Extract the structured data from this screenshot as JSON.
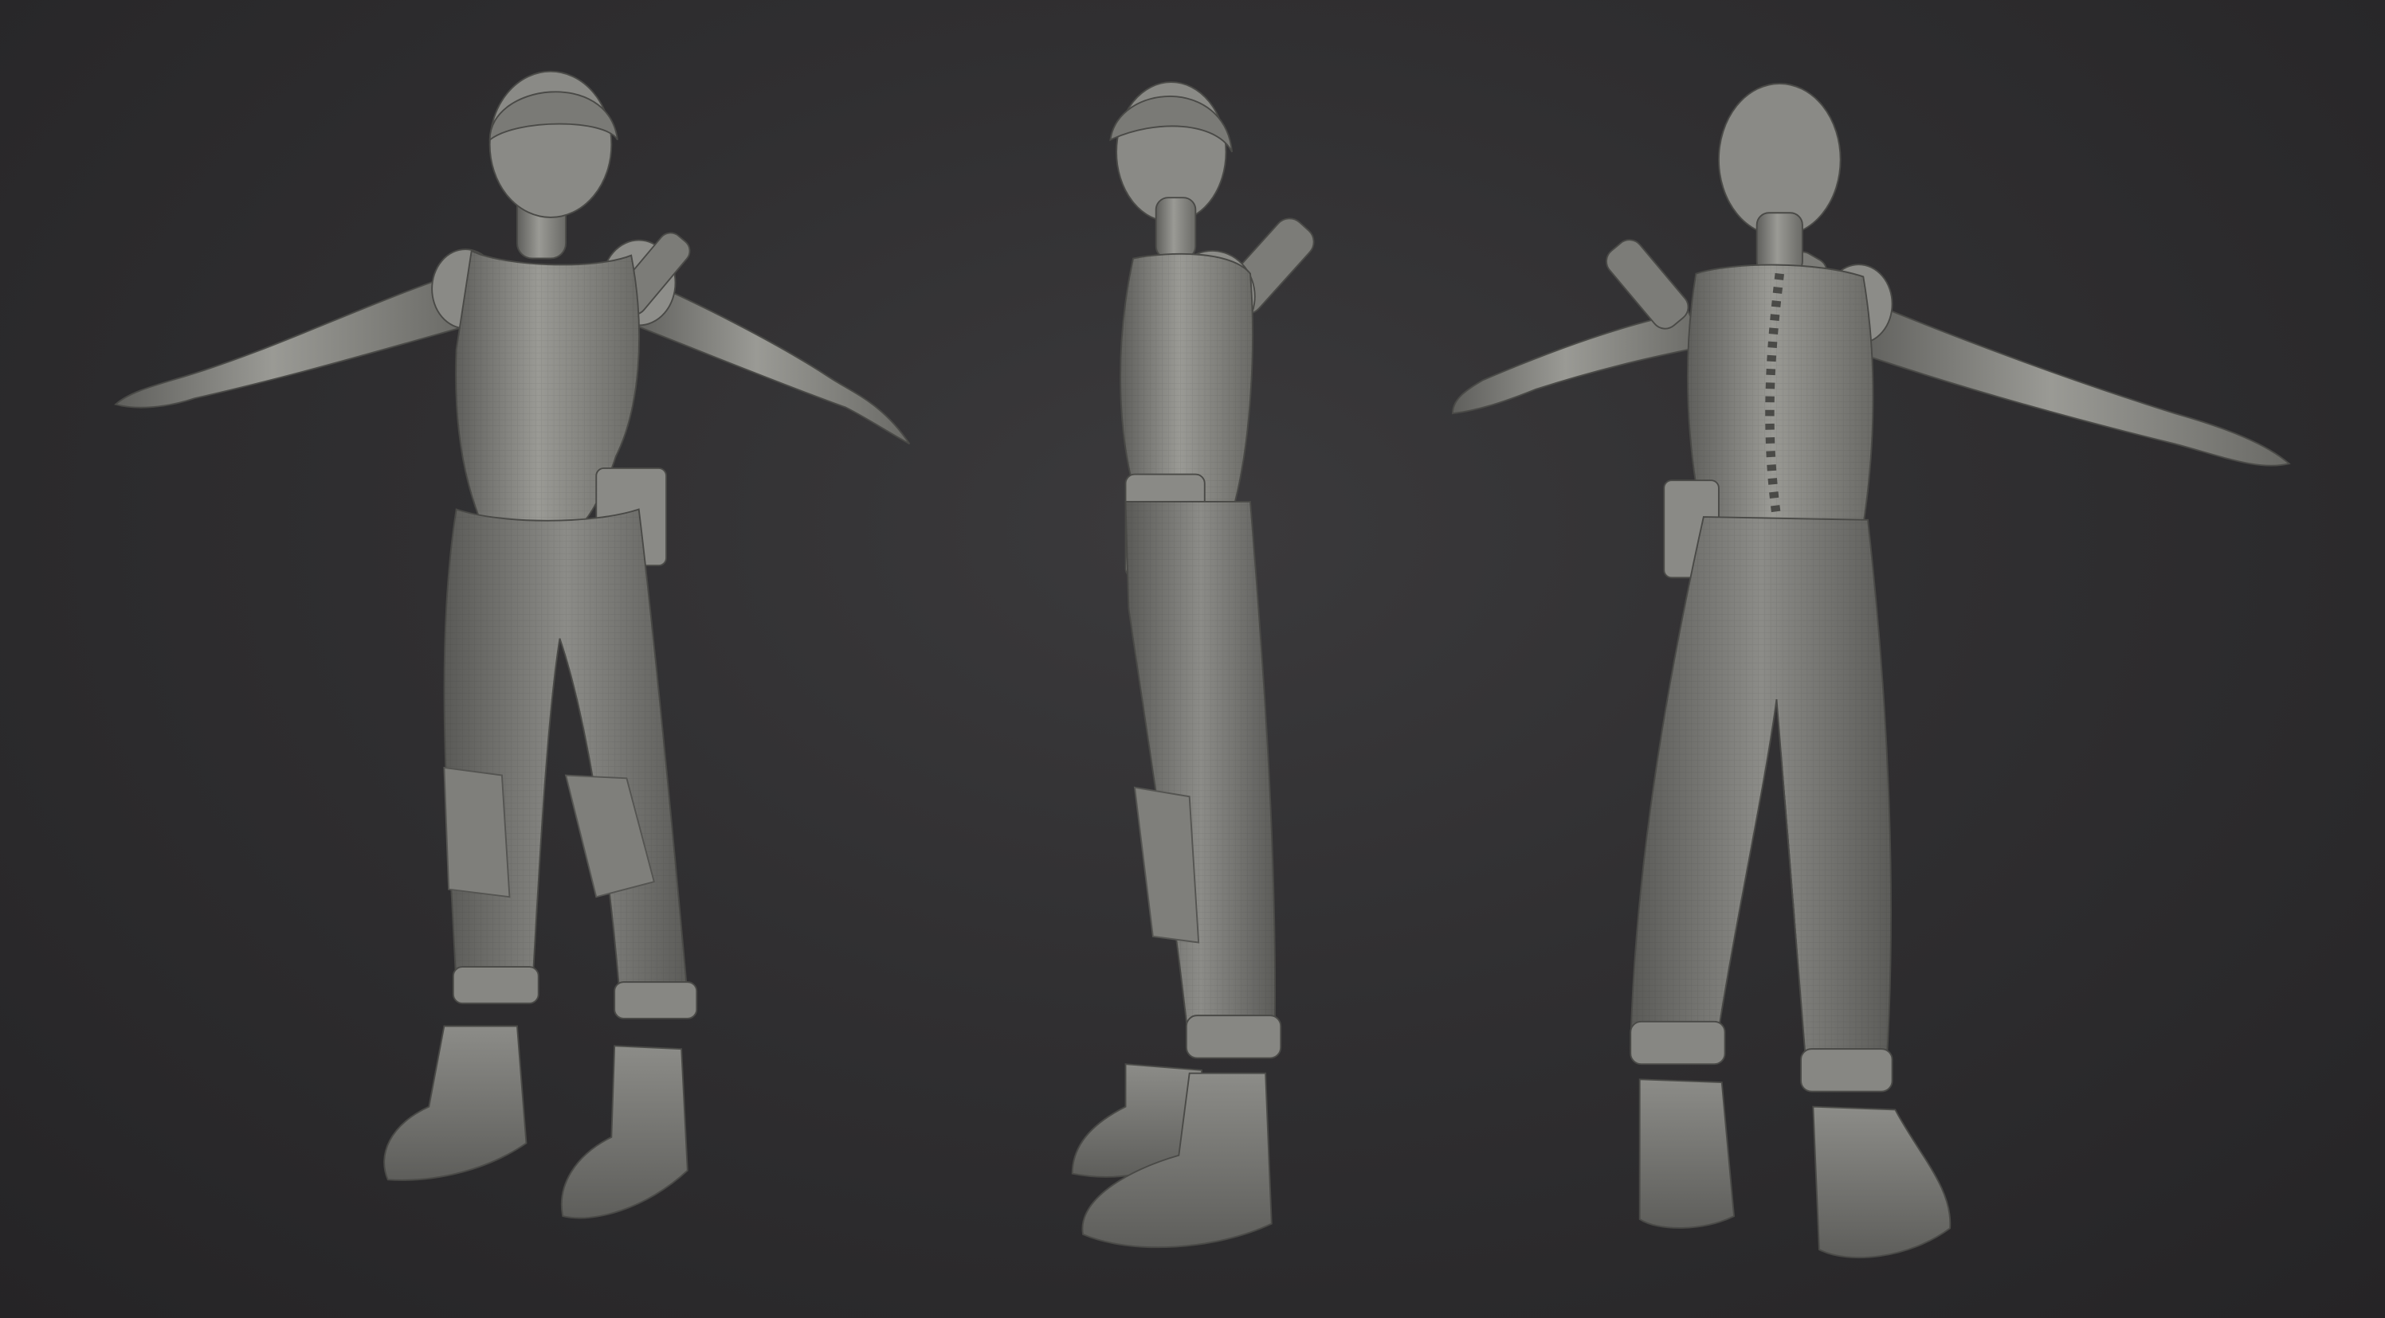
{
  "scene": {
    "background_color": "#2f2e30",
    "model_color": "#8a8a86",
    "views": [
      "front-three-quarter",
      "side",
      "back"
    ]
  }
}
